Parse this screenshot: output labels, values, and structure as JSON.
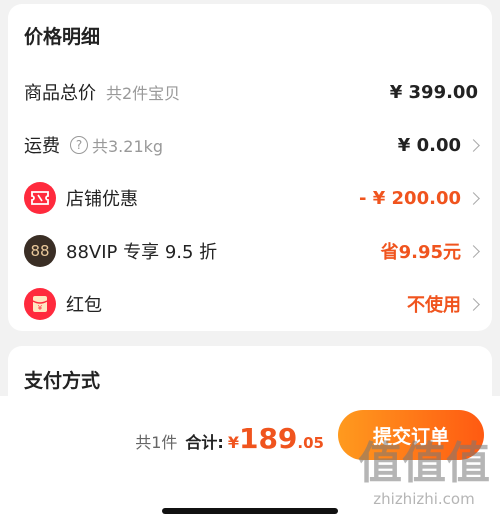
{
  "price_detail": {
    "title": "价格明细",
    "goods_total": {
      "label": "商品总价",
      "sub": "共2件宝贝",
      "value": "¥ 399.00"
    },
    "shipping": {
      "label": "运费",
      "help_glyph": "?",
      "sub": "共3.21kg",
      "value": "¥ 0.00"
    },
    "shop_discount": {
      "label": "店铺优惠",
      "value": "- ¥ 200.00",
      "icon": "ticket-icon",
      "color": "#f0541e"
    },
    "vip": {
      "label": "88VIP 专享 9.5 折",
      "badge": "88",
      "value": "省9.95元",
      "icon": "vip-badge-icon"
    },
    "red_packet": {
      "label": "红包",
      "value": "不使用",
      "icon": "red-packet-icon"
    }
  },
  "payment": {
    "title": "支付方式"
  },
  "bottom": {
    "count": "共1件",
    "total_label": "合计:",
    "currency": "¥",
    "amount_int": "189",
    "amount_dec": ".05",
    "submit": "提交订单"
  },
  "watermark": {
    "logo": "值值值",
    "url": "zhizhizhi.com"
  },
  "colors": {
    "accent": "#f0541e",
    "red_icon": "#ff2a3d",
    "vip_bg": "#3a2e25",
    "btn_start": "#ff9a1e",
    "btn_end": "#ff5a12"
  }
}
